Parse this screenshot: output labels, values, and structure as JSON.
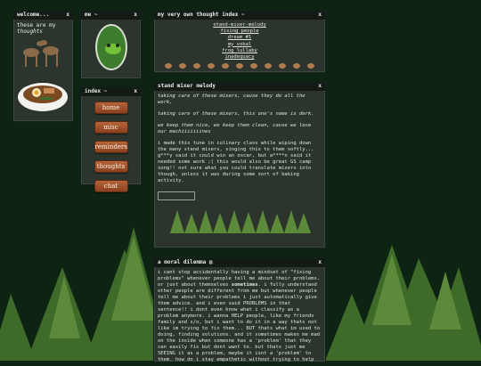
{
  "windows": {
    "welcome": {
      "title": "welcome...",
      "text_line1": "these are my",
      "text_line2": "thoughts"
    },
    "me": {
      "title": "me ~"
    },
    "thought_index": {
      "title": "my very own thought index ~",
      "links": [
        "stand-mixer-melody",
        "fixing people",
        "dream #1",
        "my vokal",
        "frog lullaby",
        "inadequacy"
      ]
    },
    "index": {
      "title": "index ~",
      "buttons": [
        "home",
        "misc",
        "reminders",
        "thoughts",
        "chat"
      ]
    },
    "melody": {
      "title": "stand mixer melody",
      "p1": "taking care of these mixers, cause they do all the work,",
      "p2": "taking care of these mixers, this one's name is derk.",
      "p3": "we keep them nice, we keep them clean, cause we love our machiiiiiiines",
      "p4": "i made this tune in culinary class while wiping down the many stand mixers, singing this to them softly... g***y said it could win an oscar, but a****n said it needed some work ;( this would also be great GS camp song!! not sure what you could translate mixers into though, unless it was during some sort of baking activity."
    },
    "dilemma": {
      "title": "a moral dilemma",
      "text_a": "i cant stop accidentally having a mindset of \"fixing problems\" whenever people tell me about their problems. or just about themselves ",
      "text_bold": "sometimes",
      "text_b": ". i fully understand other people are different from me but whenever people tell me about their problems i just automatically give them advice. and i even said PROBLEMS in that sentence!! i dont even know what i classify as a problem anymore. i wanna HELP people, like my friends family and s/o, but i want to do it in a way thats not like im trying to fix them... BUT thats what im used to doing, finding solutions. and it sometimes makes me mad on the inside when someone has a 'problem' that they can easily fix but dont want to. but thats just me SEEING it as a problem, maybe it isnt a 'problem' to them. how do i stay empathetic without trying to help"
    }
  },
  "close_glyph": "x"
}
